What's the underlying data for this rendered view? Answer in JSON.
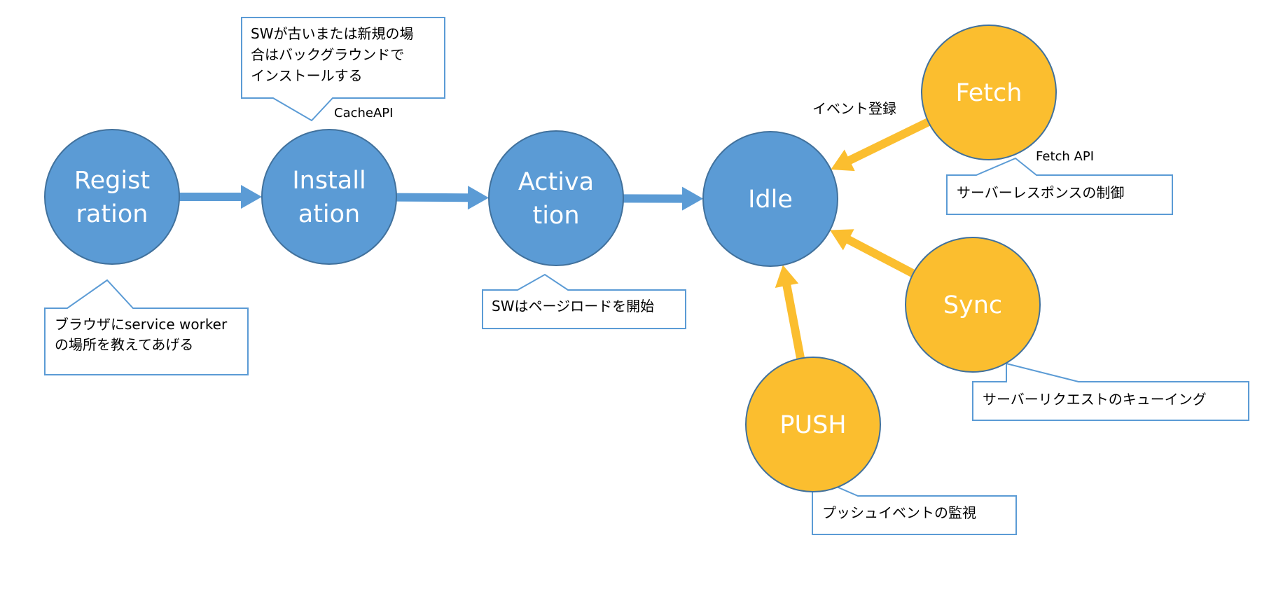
{
  "colors": {
    "phase_fill": "#5B9BD5",
    "phase_stroke": "#41719C",
    "event_fill": "#FBBE2F",
    "event_stroke": "#41719C",
    "callout_stroke": "#5B9BD5",
    "background": "#FFFFFF"
  },
  "nodes": {
    "registration": {
      "lines": [
        "Regist",
        "ration"
      ],
      "kind": "phase"
    },
    "installation": {
      "lines": [
        "Install",
        "ation"
      ],
      "kind": "phase"
    },
    "activation": {
      "lines": [
        "Activa",
        "tion"
      ],
      "kind": "phase"
    },
    "idle": {
      "lines": [
        "Idle"
      ],
      "kind": "phase"
    },
    "fetch": {
      "lines": [
        "Fetch"
      ],
      "kind": "event"
    },
    "sync": {
      "lines": [
        "Sync"
      ],
      "kind": "event"
    },
    "push": {
      "lines": [
        "PUSH"
      ],
      "kind": "event"
    }
  },
  "edges": [
    {
      "from": "registration",
      "to": "installation",
      "kind": "phase"
    },
    {
      "from": "installation",
      "to": "activation",
      "kind": "phase"
    },
    {
      "from": "activation",
      "to": "idle",
      "kind": "phase"
    },
    {
      "from": "fetch",
      "to": "idle",
      "kind": "event"
    },
    {
      "from": "sync",
      "to": "idle",
      "kind": "event"
    },
    {
      "from": "push",
      "to": "idle",
      "kind": "event"
    }
  ],
  "callouts": {
    "registration": [
      "ブラウザにservice worker",
      "の場所を教えてあげる"
    ],
    "installation": [
      "SWが古いまたは新規の場",
      "合はバックグラウンドで",
      "インストールする"
    ],
    "activation": [
      "SWはページロードを開始"
    ],
    "fetch": [
      "サーバーレスポンスの制御"
    ],
    "sync": [
      "サーバーリクエストのキューイング"
    ],
    "push": [
      "プッシュイベントの監視"
    ]
  },
  "labels": {
    "cache_api": "CacheAPI",
    "fetch_api": "Fetch API",
    "event_registration": "イベント登録"
  }
}
